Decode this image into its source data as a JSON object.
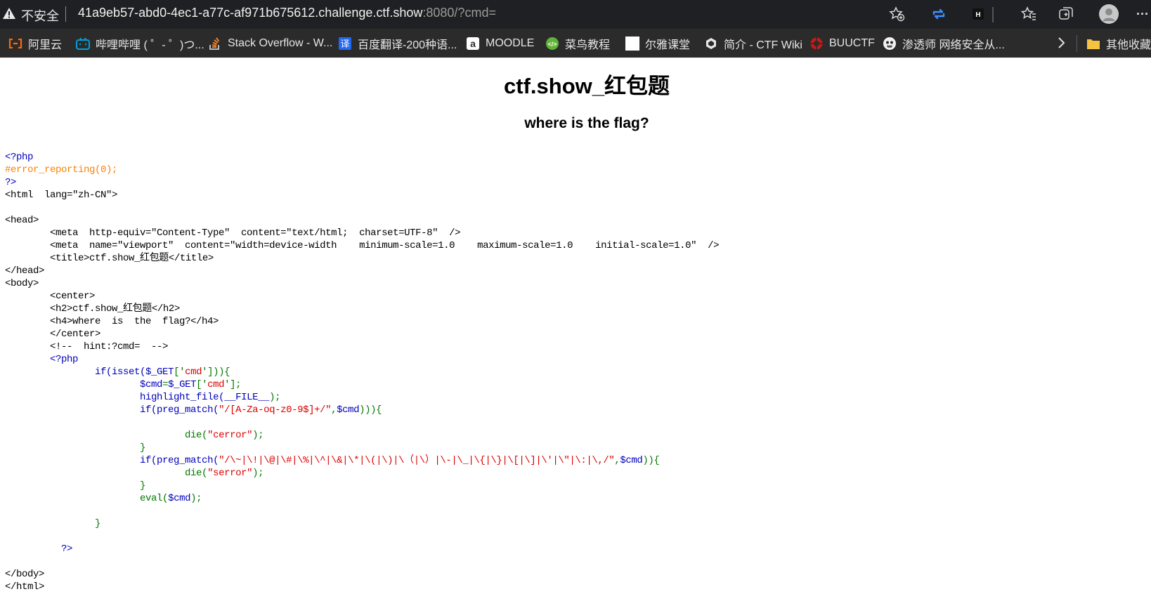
{
  "browser": {
    "insecure_label": "不安全",
    "url_host": "41a9eb57-abd0-4ec1-a77c-af971b675612.challenge.ctf.show",
    "url_rest": ":8080/?cmd=",
    "more_label": "···",
    "bookmarks": [
      {
        "label": "阿里云",
        "icon": "aliyun-icon"
      },
      {
        "label": "哔哩哔哩 ( ゜- ゜)つ...",
        "icon": "bilibili-icon"
      },
      {
        "label": "Stack Overflow - W...",
        "icon": "stackoverflow-icon"
      },
      {
        "label": "百度翻译-200种语...",
        "icon": "baidu-translate-icon"
      },
      {
        "label": "MOODLE",
        "icon": "moodle-icon"
      },
      {
        "label": "菜鸟教程",
        "icon": "runoob-icon"
      },
      {
        "label": "尔雅课堂",
        "icon": "page-icon"
      },
      {
        "label": "简介 - CTF Wiki",
        "icon": "ctfwiki-icon"
      },
      {
        "label": "BUUCTF",
        "icon": "buuctf-icon"
      },
      {
        "label": "渗透师 网络安全从...",
        "icon": "pentest-icon"
      }
    ],
    "other_bookmarks": "其他收藏"
  },
  "page": {
    "title": "ctf.show_红包题",
    "subtitle": "where is the flag?"
  },
  "source_code": [
    [
      [
        "kw",
        "<?php"
      ]
    ],
    [
      [
        "cm",
        "#error_reporting(0);"
      ]
    ],
    [
      [
        "kw",
        "?>"
      ]
    ],
    [
      [
        "hm",
        "<html  lang=\"zh-CN\">"
      ]
    ],
    [
      [
        "hm",
        ""
      ]
    ],
    [
      [
        "hm",
        "<head>"
      ]
    ],
    [
      [
        "hm",
        "        <meta  http-equiv=\"Content-Type\"  content=\"text/html;  charset=UTF-8\"  />"
      ]
    ],
    [
      [
        "hm",
        "        <meta  name=\"viewport\"  content=\"width=device-width    minimum-scale=1.0    maximum-scale=1.0    initial-scale=1.0\"  />"
      ]
    ],
    [
      [
        "hm",
        "        <title>ctf.show_红包题</title>"
      ]
    ],
    [
      [
        "hm",
        "</head>"
      ]
    ],
    [
      [
        "hm",
        "<body>"
      ]
    ],
    [
      [
        "hm",
        "        <center>"
      ]
    ],
    [
      [
        "hm",
        "        <h2>ctf.show_红包题</h2>"
      ]
    ],
    [
      [
        "hm",
        "        <h4>where  is  the  flag?</h4>"
      ]
    ],
    [
      [
        "hm",
        "        </center>"
      ]
    ],
    [
      [
        "hm",
        "        <!--  hint:?cmd=  -->"
      ]
    ],
    [
      [
        "hm",
        "        "
      ],
      [
        "kw",
        "<?php"
      ]
    ],
    [
      [
        "hm",
        "                "
      ],
      [
        "kw",
        "if(isset("
      ],
      [
        "kw",
        "$_GET"
      ],
      [
        "gr",
        "['"
      ],
      [
        "st",
        "cmd"
      ],
      [
        "gr",
        "'])){"
      ]
    ],
    [
      [
        "hm",
        "                        "
      ],
      [
        "kw",
        "$cmd"
      ],
      [
        "gr",
        "="
      ],
      [
        "kw",
        "$_GET"
      ],
      [
        "gr",
        "['"
      ],
      [
        "st",
        "cmd"
      ],
      [
        "gr",
        "'];"
      ]
    ],
    [
      [
        "hm",
        "                        "
      ],
      [
        "kw",
        "highlight_file("
      ],
      [
        "kw",
        "__FILE__"
      ],
      [
        "gr",
        ");"
      ]
    ],
    [
      [
        "hm",
        "                        "
      ],
      [
        "kw",
        "if(preg_match("
      ],
      [
        "st",
        "\"/[A-Za-oq-z0-9$]+/\""
      ],
      [
        "gr",
        ","
      ],
      [
        "kw",
        "$cmd"
      ],
      [
        "gr",
        "))){"
      ]
    ],
    [
      [
        "hm",
        ""
      ]
    ],
    [
      [
        "hm",
        "                                "
      ],
      [
        "gr",
        "die("
      ],
      [
        "st",
        "\"cerror\""
      ],
      [
        "gr",
        ");"
      ]
    ],
    [
      [
        "hm",
        "                        "
      ],
      [
        "gr",
        "}"
      ]
    ],
    [
      [
        "hm",
        "                        "
      ],
      [
        "kw",
        "if(preg_match("
      ],
      [
        "st",
        "\"/\\~|\\!|\\@|\\#|\\%|\\^|\\&|\\*|\\(|\\)|\\（|\\）|\\-|\\_|\\{|\\}|\\[|\\]|\\'|\\\"|\\:|\\,/\""
      ],
      [
        "gr",
        ","
      ],
      [
        "kw",
        "$cmd"
      ],
      [
        "gr",
        ")){"
      ]
    ],
    [
      [
        "hm",
        "                                "
      ],
      [
        "gr",
        "die("
      ],
      [
        "st",
        "\"serror\""
      ],
      [
        "gr",
        ");"
      ]
    ],
    [
      [
        "hm",
        "                        "
      ],
      [
        "gr",
        "}"
      ]
    ],
    [
      [
        "hm",
        "                        "
      ],
      [
        "gr",
        "eval("
      ],
      [
        "kw",
        "$cmd"
      ],
      [
        "gr",
        ");"
      ]
    ],
    [
      [
        "hm",
        ""
      ]
    ],
    [
      [
        "hm",
        "                "
      ],
      [
        "gr",
        "}"
      ]
    ],
    [
      [
        "hm",
        ""
      ]
    ],
    [
      [
        "hm",
        "          "
      ],
      [
        "kw",
        "?>"
      ]
    ],
    [
      [
        "hm",
        ""
      ]
    ],
    [
      [
        "hm",
        "</body>"
      ]
    ],
    [
      [
        "hm",
        "</html>"
      ]
    ]
  ]
}
